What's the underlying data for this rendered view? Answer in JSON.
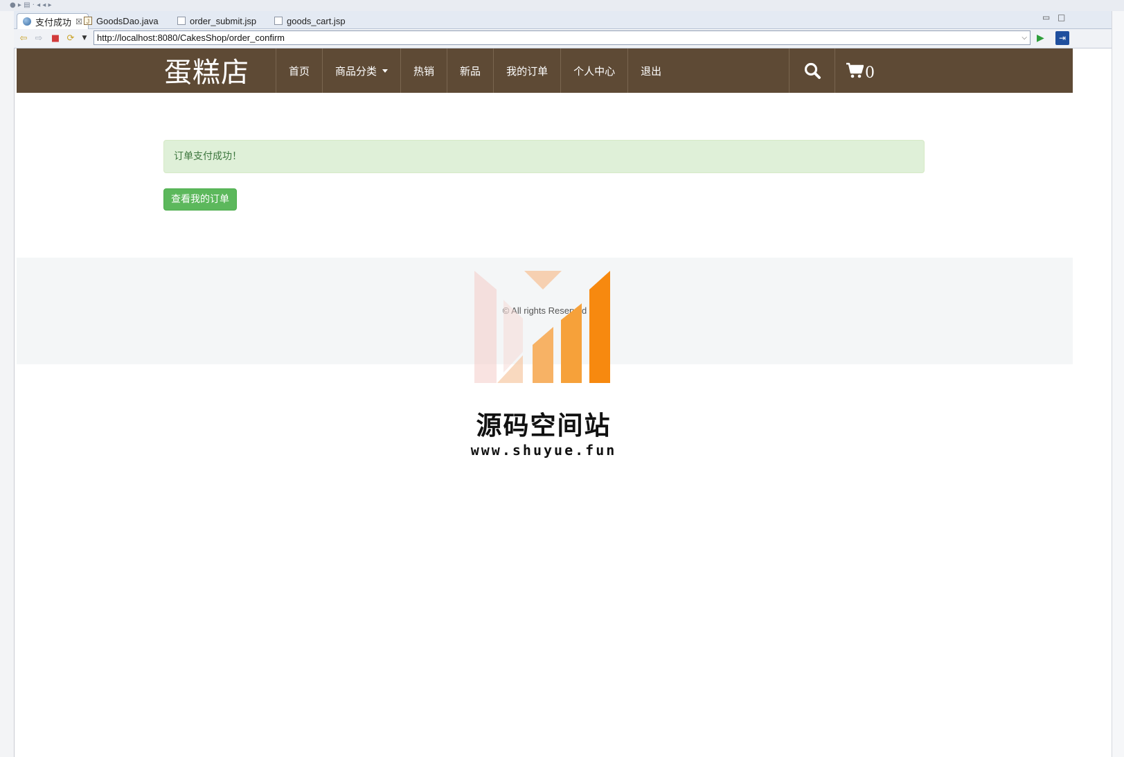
{
  "ide": {
    "tabs": [
      {
        "label": "支付成功",
        "close": "☒"
      },
      {
        "label": "GoodsDao.java"
      },
      {
        "label": "order_submit.jsp"
      },
      {
        "label": "goods_cart.jsp"
      }
    ],
    "url": "http://localhost:8080/CakesShop/order_confirm"
  },
  "site": {
    "brand": "蛋糕店",
    "nav": [
      "首页",
      "商品分类",
      "热销",
      "新品",
      "我的订单",
      "个人中心",
      "退出"
    ],
    "cart_count": "0"
  },
  "main": {
    "alert_text": "订单支付成功！",
    "view_orders_button": "查看我的订单"
  },
  "footer": {
    "copyright": "© All rights Reserved"
  },
  "watermark": {
    "title": "源码空间站",
    "url": "www.shuyue.fun"
  },
  "colors": {
    "header_bg": "#5e4a35",
    "alert_bg": "#dff0d8",
    "alert_text": "#3c763d",
    "button_bg": "#5cb85c",
    "footer_bg": "#f4f6f7"
  }
}
